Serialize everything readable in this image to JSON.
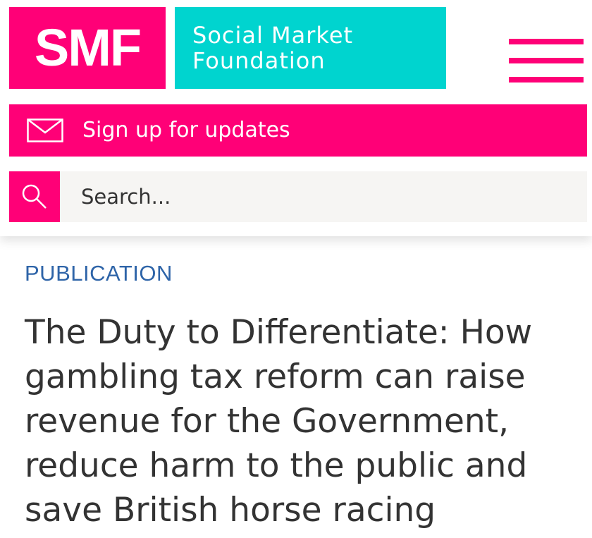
{
  "header": {
    "logo_abbr": "SMF",
    "logo_name_line1": "Social Market",
    "logo_name_line2": "Foundation",
    "menu_icon": "hamburger-menu-icon"
  },
  "signup": {
    "label": "Sign up for updates",
    "icon": "mail-icon"
  },
  "search": {
    "placeholder": "Search...",
    "value": "",
    "icon": "search-icon"
  },
  "article": {
    "category": "PUBLICATION",
    "title": "The Duty to Differentiate: How gambling tax reform can raise revenue for the Government, reduce harm to the public and save British horse racing"
  },
  "colors": {
    "brand_pink": "#ff0077",
    "brand_teal": "#00d4cf",
    "category_blue": "#2e64a8",
    "text_dark": "#333333",
    "search_bg": "#f6f5f3"
  }
}
